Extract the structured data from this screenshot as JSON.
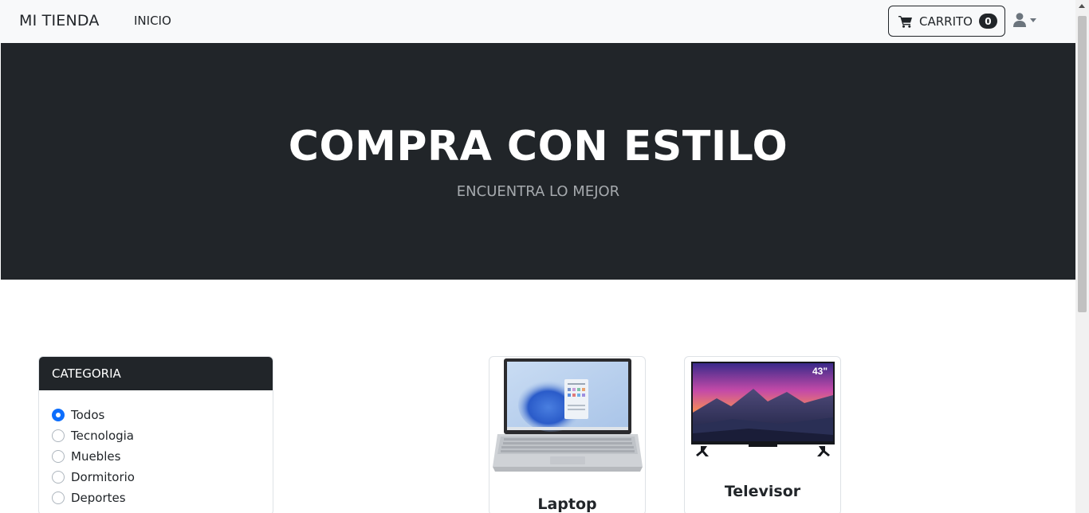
{
  "navbar": {
    "brand": "MI TIENDA",
    "link_inicio": "INICIO",
    "cart_label": "CARRITO",
    "cart_count": "0",
    "user_icon": "user-icon"
  },
  "hero": {
    "title": "COMPRA CON ESTILO",
    "subtitle": "ENCUENTRA LO MEJOR"
  },
  "categories": {
    "header": "CATEGORIA",
    "items": [
      {
        "label": "Todos",
        "checked": true
      },
      {
        "label": "Tecnologia",
        "checked": false
      },
      {
        "label": "Muebles",
        "checked": false
      },
      {
        "label": "Dormitorio",
        "checked": false
      },
      {
        "label": "Deportes",
        "checked": false
      }
    ]
  },
  "products": [
    {
      "name": "Laptop",
      "image": "laptop-image"
    },
    {
      "name": "Televisor",
      "image": "tv-image",
      "badge": "43\""
    }
  ],
  "colors": {
    "dark": "#212529",
    "accent": "#0d6efd",
    "navbar_bg": "#f8f9fa"
  }
}
